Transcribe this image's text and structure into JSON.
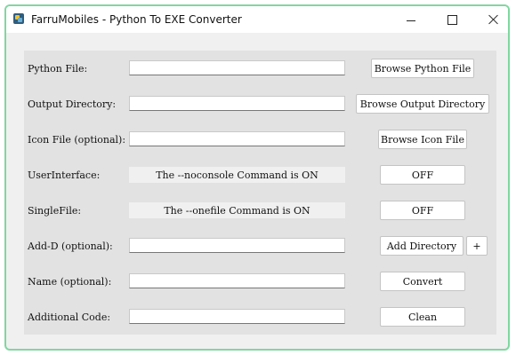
{
  "window": {
    "title": "FarruMobiles - Python To EXE Converter",
    "icon": "app-icon"
  },
  "form": {
    "python_file": {
      "label": "Python File:",
      "value": "",
      "button": "Browse Python File"
    },
    "output_directory": {
      "label": "Output Directory:",
      "value": "",
      "button": "Browse Output Directory"
    },
    "icon_file": {
      "label": "Icon File (optional):",
      "value": "",
      "button": "Browse Icon File"
    },
    "user_interface": {
      "label": "UserInterface:",
      "status": "The --noconsole Command is ON",
      "button": "OFF"
    },
    "single_file": {
      "label": "SingleFile:",
      "status": "The --onefile Command is ON",
      "button": "OFF"
    },
    "add_d": {
      "label": "Add-D (optional):",
      "value": "",
      "button": "Add Directory",
      "plus_button": "+"
    },
    "name": {
      "label": "Name (optional):",
      "value": "",
      "button": "Convert"
    },
    "additional_code": {
      "label": "Additional Code:",
      "value": "",
      "button": "Clean"
    }
  }
}
